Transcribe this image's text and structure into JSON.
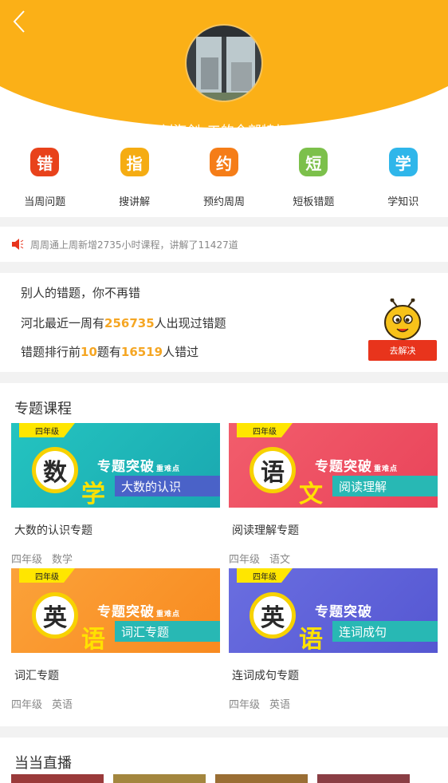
{
  "header": {
    "user_title": "刘海剑_工的全部特权",
    "brand_color": "#fbb017"
  },
  "privileges": [
    {
      "icon_char": "错",
      "label": "当周问题",
      "color": "#e8421b",
      "icon": "error-icon"
    },
    {
      "icon_char": "指",
      "label": "搜讲解",
      "color": "#f5ac12",
      "icon": "point-icon"
    },
    {
      "icon_char": "约",
      "label": "预约周周",
      "color": "#f57d18",
      "icon": "appointment-icon"
    },
    {
      "icon_char": "短",
      "label": "短板错题",
      "color": "#7cc04b",
      "icon": "weakness-icon"
    },
    {
      "icon_char": "学",
      "label": "学知识",
      "color": "#2fb6ea",
      "icon": "study-icon"
    }
  ],
  "notice": {
    "text": "周周通上周新增2735小时课程，讲解了11427道"
  },
  "mistakes": {
    "line1": "别人的错题，你不再错",
    "line2_prefix": "河北最近一周有",
    "line2_count": "256735",
    "line2_suffix": "人出现过错题",
    "line3_prefix": "错题排行前",
    "line3_top": "10",
    "line3_mid": "题有",
    "line3_count": "16519",
    "line3_suffix": "人错过",
    "solve_button": "去解决"
  },
  "courses": {
    "title": "专题课程",
    "items": [
      {
        "grade_tag": "四年级",
        "badge": "数",
        "badge_sub": "学",
        "banner_heading": "专题突破",
        "banner_note": "重难点",
        "banner_strip": "大数的认识",
        "title": "大数的认识专题",
        "grade": "四年级",
        "subject": "数学",
        "bg_from": "#24c4c0",
        "bg_to": "#1aa8b0",
        "strip_color": "#4a62c8"
      },
      {
        "grade_tag": "四年级",
        "badge": "语",
        "badge_sub": "文",
        "banner_heading": "专题突破",
        "banner_note": "重难点",
        "banner_strip": "阅读理解",
        "title": "阅读理解专题",
        "grade": "四年级",
        "subject": "语文",
        "bg_from": "#f25d6c",
        "bg_to": "#e9445a",
        "strip_color": "#28b8b4"
      },
      {
        "grade_tag": "四年级",
        "badge": "英",
        "badge_sub": "语",
        "banner_heading": "专题突破",
        "banner_note": "重难点",
        "banner_strip": "词汇专题",
        "title": "词汇专题",
        "grade": "四年级",
        "subject": "英语",
        "bg_from": "#fba23a",
        "bg_to": "#f88a1f",
        "strip_color": "#28b8b4"
      },
      {
        "grade_tag": "四年级",
        "badge": "英",
        "badge_sub": "语",
        "banner_heading": "专题突破",
        "banner_note": "",
        "banner_strip": "连词成句",
        "title": "连词成句专题",
        "grade": "四年级",
        "subject": "英语",
        "bg_from": "#6a6ee0",
        "bg_to": "#5557d2",
        "strip_color": "#28b8b4"
      }
    ]
  },
  "live": {
    "title": "当当直播"
  }
}
